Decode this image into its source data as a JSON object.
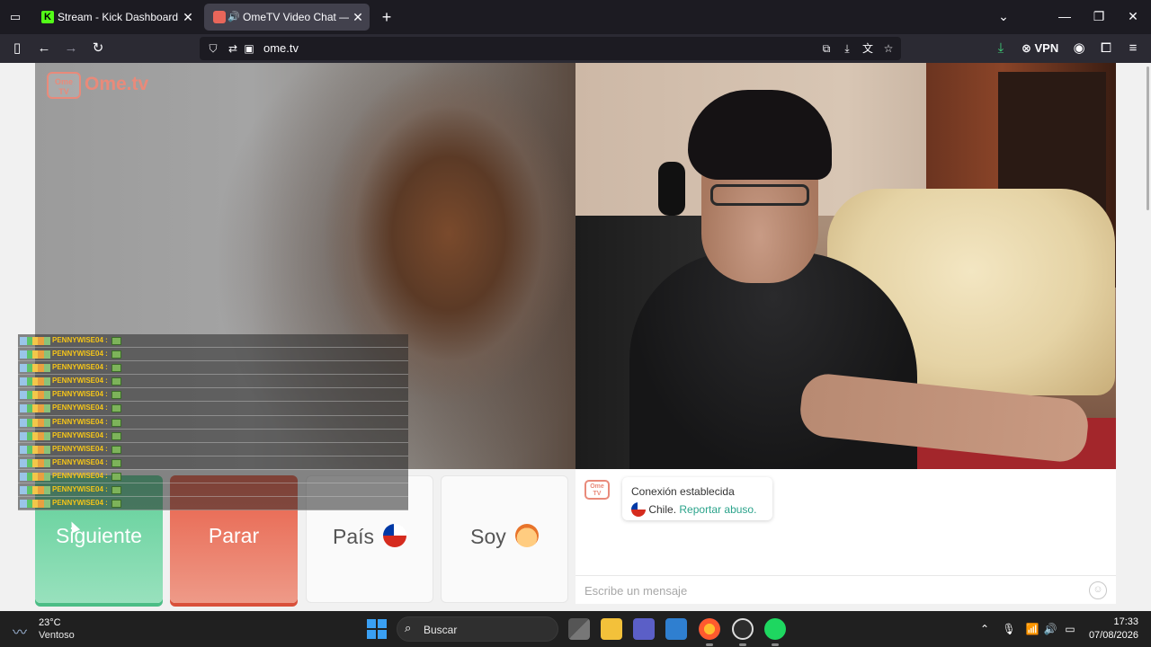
{
  "browser": {
    "tabs": [
      {
        "title": "Stream - Kick Dashboard",
        "favicon": "kick-icon",
        "favicon_letter": "K"
      },
      {
        "title": "OmeTV Video Chat — Ome",
        "favicon": "ometv-icon",
        "active": true,
        "audio": true
      }
    ],
    "new_tab": "+",
    "url": "ome.tv",
    "vpn_label": "VPN",
    "window_controls": {
      "minimize": "—",
      "maximize": "❐",
      "close": "✕"
    }
  },
  "ometv": {
    "logo_badge_top": "Ome",
    "logo_badge_bottom": "TV",
    "logo_text": "Ome.tv",
    "buttons": {
      "next": "Siguiente",
      "stop": "Parar",
      "country": "País",
      "gender": "Soy"
    },
    "system_message": {
      "line1": "Conexión establecida",
      "country": "Chile.",
      "report": "Reportar abuso."
    },
    "message_input": {
      "placeholder": "Escribe un mensaje"
    }
  },
  "stream_chat": {
    "messages": [
      {
        "user": "PENNYWISE04 :"
      },
      {
        "user": "PENNYWISE04 :"
      },
      {
        "user": "PENNYWISE04 :"
      },
      {
        "user": "PENNYWISE04 :"
      },
      {
        "user": "PENNYWISE04 :"
      },
      {
        "user": "PENNYWISE04 :"
      },
      {
        "user": "PENNYWISE04 :"
      },
      {
        "user": "PENNYWISE04 :"
      },
      {
        "user": "PENNYWISE04 :"
      },
      {
        "user": "PENNYWISE04 :"
      },
      {
        "user": "PENNYWISE04 :"
      },
      {
        "user": "PENNYWISE04 :"
      },
      {
        "user": "PENNYWISE04 :"
      }
    ]
  },
  "taskbar": {
    "weather": {
      "temp": "23°C",
      "desc": "Ventoso"
    },
    "search_label": "Buscar",
    "clock": {
      "time": "17:33",
      "date": "07/08/2026"
    }
  },
  "colors": {
    "next_button": "#5fcf98",
    "stop_button": "#e85f48",
    "ometv_brand": "#e98a7a",
    "report_link": "#2ba38b"
  }
}
